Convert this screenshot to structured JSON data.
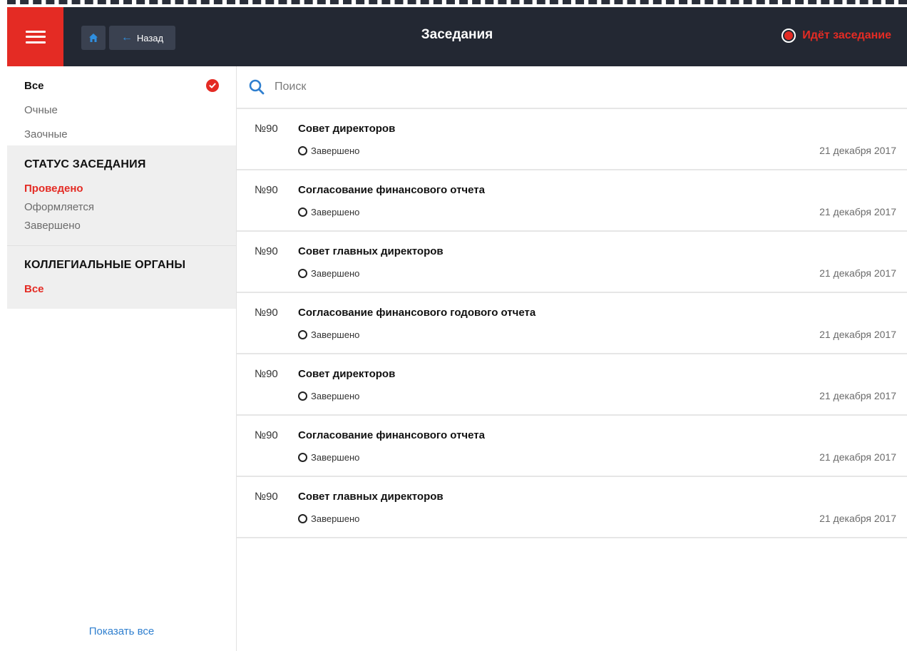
{
  "header": {
    "back_label": "Назад",
    "title": "Заседания",
    "live_label": "Идёт заседание"
  },
  "colors": {
    "accent_red": "#e42b24",
    "header_bg": "#232833",
    "link_blue": "#2f7fcf"
  },
  "sidebar": {
    "types": [
      {
        "label": "Все",
        "selected": true
      },
      {
        "label": "Очные",
        "selected": false
      },
      {
        "label": "Заочные",
        "selected": false
      }
    ],
    "status_group": {
      "title": "СТАТУС ЗАСЕДАНИЯ",
      "items": [
        {
          "label": "Проведено",
          "active": true
        },
        {
          "label": "Оформляется",
          "active": false
        },
        {
          "label": "Завершено",
          "active": false
        }
      ]
    },
    "organs_group": {
      "title": "КОЛЛЕГИАЛЬНЫЕ ОРГАНЫ",
      "items": [
        {
          "label": "Все",
          "active": true
        }
      ]
    },
    "show_all_label": "Показать все"
  },
  "search": {
    "placeholder": "Поиск",
    "value": ""
  },
  "meetings": [
    {
      "number": "№90",
      "title": "Совет директоров",
      "status": "Завершено",
      "date": "21 декабря 2017"
    },
    {
      "number": "№90",
      "title": "Согласование финансового отчета",
      "status": "Завершено",
      "date": "21 декабря 2017"
    },
    {
      "number": "№90",
      "title": "Совет главных директоров",
      "status": "Завершено",
      "date": "21 декабря 2017"
    },
    {
      "number": "№90",
      "title": "Согласование финансового годового отчета",
      "status": "Завершено",
      "date": "21 декабря 2017"
    },
    {
      "number": "№90",
      "title": "Совет директоров",
      "status": "Завершено",
      "date": "21 декабря 2017"
    },
    {
      "number": "№90",
      "title": "Согласование финансового отчета",
      "status": "Завершено",
      "date": "21 декабря 2017"
    },
    {
      "number": "№90",
      "title": "Совет главных директоров",
      "status": "Завершено",
      "date": "21 декабря 2017"
    }
  ]
}
